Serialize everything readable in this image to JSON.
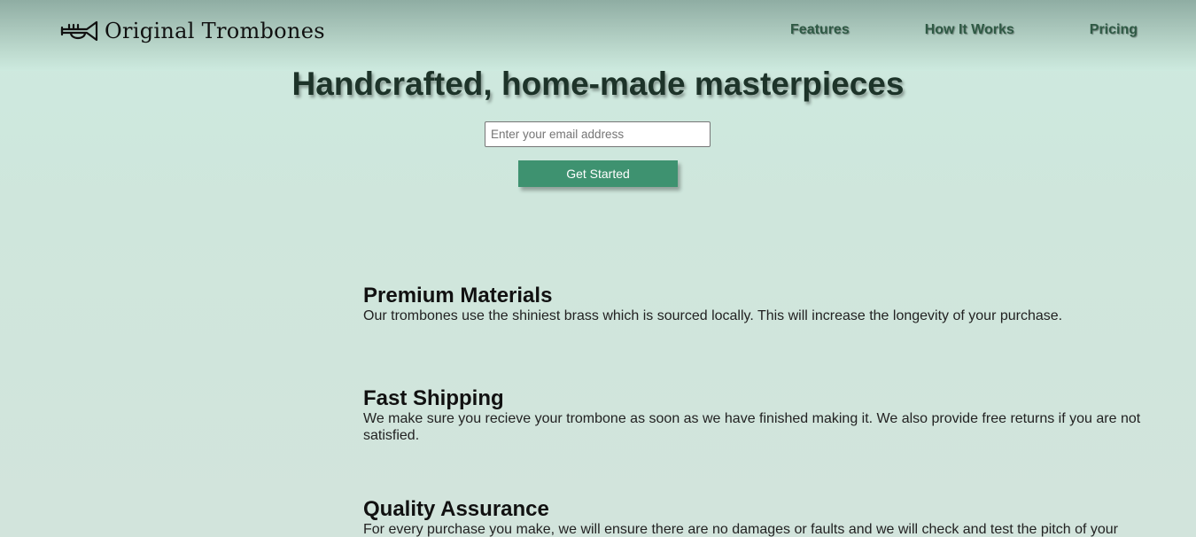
{
  "header": {
    "brand": "Original Trombones",
    "logo_icon": "trumpet-icon",
    "nav": [
      {
        "label": "Features"
      },
      {
        "label": "How It Works"
      },
      {
        "label": "Pricing"
      }
    ]
  },
  "hero": {
    "title": "Handcrafted, home-made masterpieces",
    "email_placeholder": "Enter your email address",
    "email_value": "",
    "cta_label": "Get Started"
  },
  "features": [
    {
      "title": "Premium Materials",
      "text": "Our trombones use the shiniest brass which is sourced locally. This will increase the longevity of your purchase."
    },
    {
      "title": "Fast Shipping",
      "text": "We make sure you recieve your trombone as soon as we have finished making it. We also provide free returns if you are not satisfied."
    },
    {
      "title": "Quality Assurance",
      "text": "For every purchase you make, we will ensure there are no damages or faults and we will check and test the pitch of your"
    }
  ],
  "colors": {
    "accent": "#3e9270",
    "nav_text": "#2f5a45",
    "background": "#cfe6dc"
  }
}
